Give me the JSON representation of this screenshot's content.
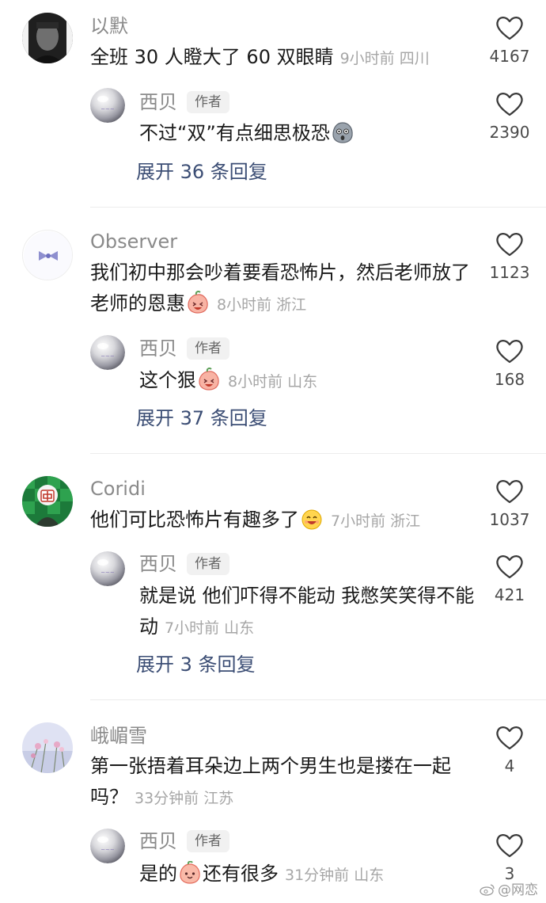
{
  "author_tag": "作者",
  "threads": [
    {
      "user": "以默",
      "text": "全班 30 人瞪大了 60 双眼睛",
      "meta": "9小时前 四川",
      "likes": "4167",
      "reply": {
        "user": "西贝",
        "text": "不过“双”有点细思极恐",
        "emoji": "shocked-face-emoji",
        "meta": "",
        "likes": "2390"
      },
      "expand": "展开 36 条回复"
    },
    {
      "user": "Observer",
      "text": "我们初中那会吵着要看恐怖片，然后老师放了老师的恩惠",
      "emoji": "laughing-peach-emoji",
      "meta": "8小时前 浙江",
      "likes": "1123",
      "reply": {
        "user": "西贝",
        "text": "这个狠",
        "emoji": "laughing-peach-emoji",
        "meta": "8小时前 山东",
        "likes": "168"
      },
      "expand": "展开 37 条回复"
    },
    {
      "user": "Coridi",
      "text": "他们可比恐怖片有趣多了",
      "emoji": "grinning-face-emoji",
      "meta": "7小时前 浙江",
      "likes": "1037",
      "reply": {
        "user": "西贝",
        "text": "就是说 他们吓得不能动 我憋笑笑得不能动",
        "meta": "7小时前 山东",
        "likes": "421"
      },
      "expand": "展开 3 条回复"
    },
    {
      "user": "峨嵋雪",
      "text": "第一张捂着耳朵边上两个男生也是搂在一起吗？",
      "meta": "33分钟前 江苏",
      "likes": "4",
      "reply": {
        "user": "西贝",
        "text_before": "是的",
        "emoji": "smiling-peach-emoji",
        "text_after": "还有很多",
        "meta": "31分钟前 山东",
        "likes": "3"
      }
    }
  ],
  "watermark": "@网恋",
  "colors": {
    "name": "#8a8a8a",
    "meta": "#a6a6a6",
    "expand": "#3b4d74",
    "separator": "#ececec"
  }
}
